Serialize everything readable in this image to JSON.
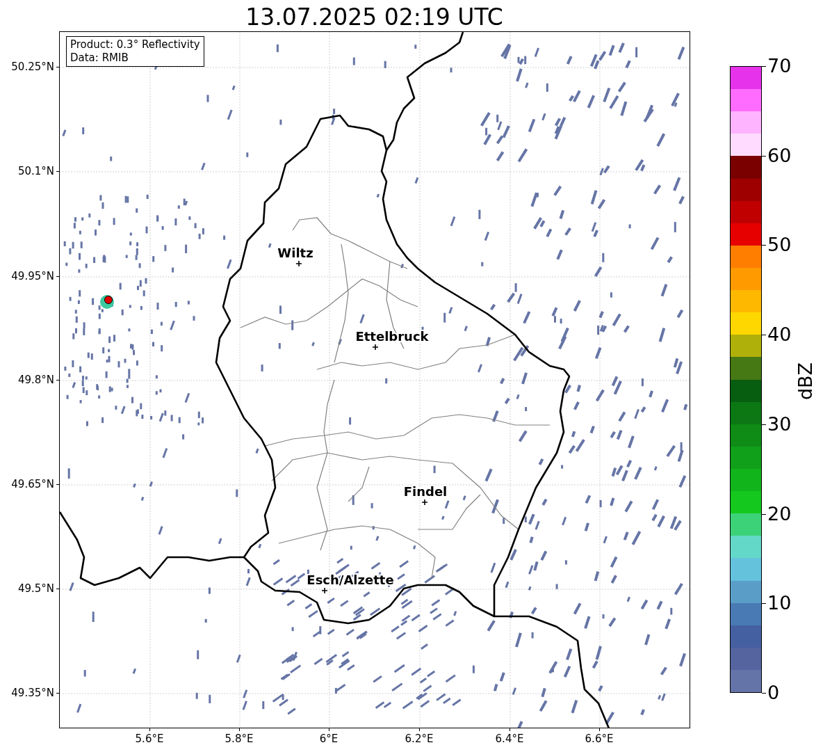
{
  "title": "13.07.2025 02:19 UTC",
  "info_box": [
    "Product: 0.3° Reflectivity",
    "Data: RMIB"
  ],
  "map": {
    "x_ticks": [
      "5.6°E",
      "5.8°E",
      "6°E",
      "6.2°E",
      "6.4°E",
      "6.6°E"
    ],
    "y_ticks": [
      "50.25°N",
      "50.1°N",
      "49.95°N",
      "49.8°N",
      "49.65°N",
      "49.5°N",
      "49.35°N"
    ],
    "cities": [
      {
        "name": "Wiltz"
      },
      {
        "name": "Ettelbruck"
      },
      {
        "name": "Findel"
      },
      {
        "name": "Esch/Alzette"
      }
    ]
  },
  "colorbar": {
    "label": "dBZ",
    "ticks": [
      "70",
      "60",
      "50",
      "40",
      "30",
      "20",
      "10",
      "0"
    ],
    "segments": [
      {
        "color": "#e632eb"
      },
      {
        "color": "#ff6cff"
      },
      {
        "color": "#ffb4ff"
      },
      {
        "color": "#ffdcff"
      },
      {
        "color": "#7a0000"
      },
      {
        "color": "#9e0000"
      },
      {
        "color": "#c00000"
      },
      {
        "color": "#e60000"
      },
      {
        "color": "#ff7e00"
      },
      {
        "color": "#ff9a00"
      },
      {
        "color": "#ffb800"
      },
      {
        "color": "#ffd700"
      },
      {
        "color": "#b0b00a"
      },
      {
        "color": "#467814"
      },
      {
        "color": "#085e10"
      },
      {
        "color": "#0c7814"
      },
      {
        "color": "#0e8c16"
      },
      {
        "color": "#10a01a"
      },
      {
        "color": "#12b41c"
      },
      {
        "color": "#14c81e"
      },
      {
        "color": "#3cd278"
      },
      {
        "color": "#64d8c8"
      },
      {
        "color": "#64c2dc"
      },
      {
        "color": "#5a9ec8"
      },
      {
        "color": "#4a7ab4"
      },
      {
        "color": "#4560a0"
      },
      {
        "color": "#55649e"
      },
      {
        "color": "#6574a8"
      }
    ]
  }
}
